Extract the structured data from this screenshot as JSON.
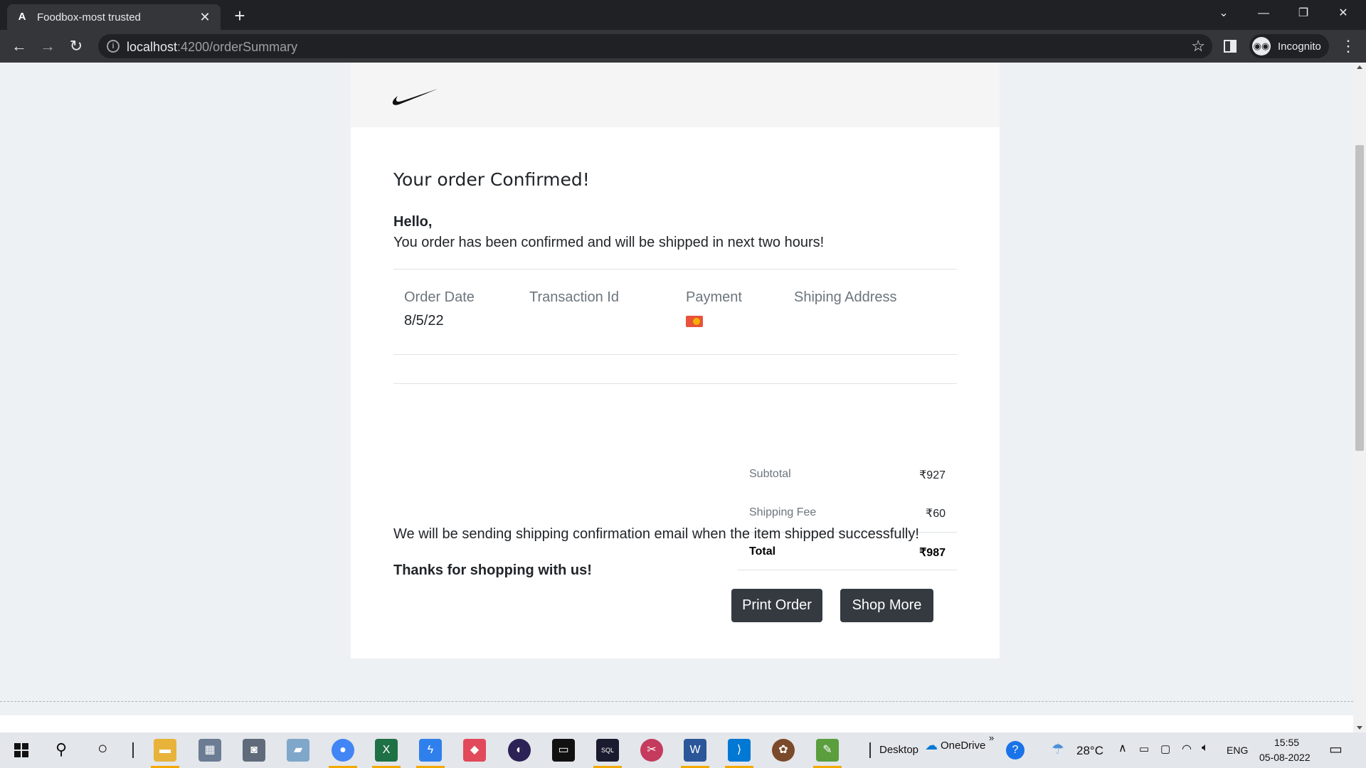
{
  "browser": {
    "tab_title": "Foodbox-most trusted",
    "tab_favicon": "A",
    "url_host": "localhost",
    "url_path": ":4200/orderSummary",
    "profile_label": "Incognito"
  },
  "order": {
    "heading": "Your order Confirmed!",
    "greeting": "Hello,",
    "message": "You order has been confirmed and will be shipped in next two hours!",
    "columns": {
      "order_date_label": "Order Date",
      "order_date_value": "8/5/22",
      "transaction_label": "Transaction Id",
      "payment_label": "Payment",
      "address_label": "Shiping Address"
    },
    "totals": {
      "subtotal_label": "Subtotal",
      "subtotal_value": "₹927",
      "shipping_label": "Shipping Fee",
      "shipping_value": "₹60",
      "total_label": "Total",
      "total_value": "₹987"
    },
    "shipping_note": "We will be sending shipping confirmation email when the item shipped successfully!",
    "thanks": "Thanks for shopping with us!",
    "print_button": "Print Order",
    "shop_button": "Shop More"
  },
  "taskbar": {
    "desktop_label": "Desktop",
    "onedrive_label": "OneDrive",
    "temperature": "28°C",
    "language": "ENG",
    "time": "15:55",
    "date": "05-08-2022"
  }
}
